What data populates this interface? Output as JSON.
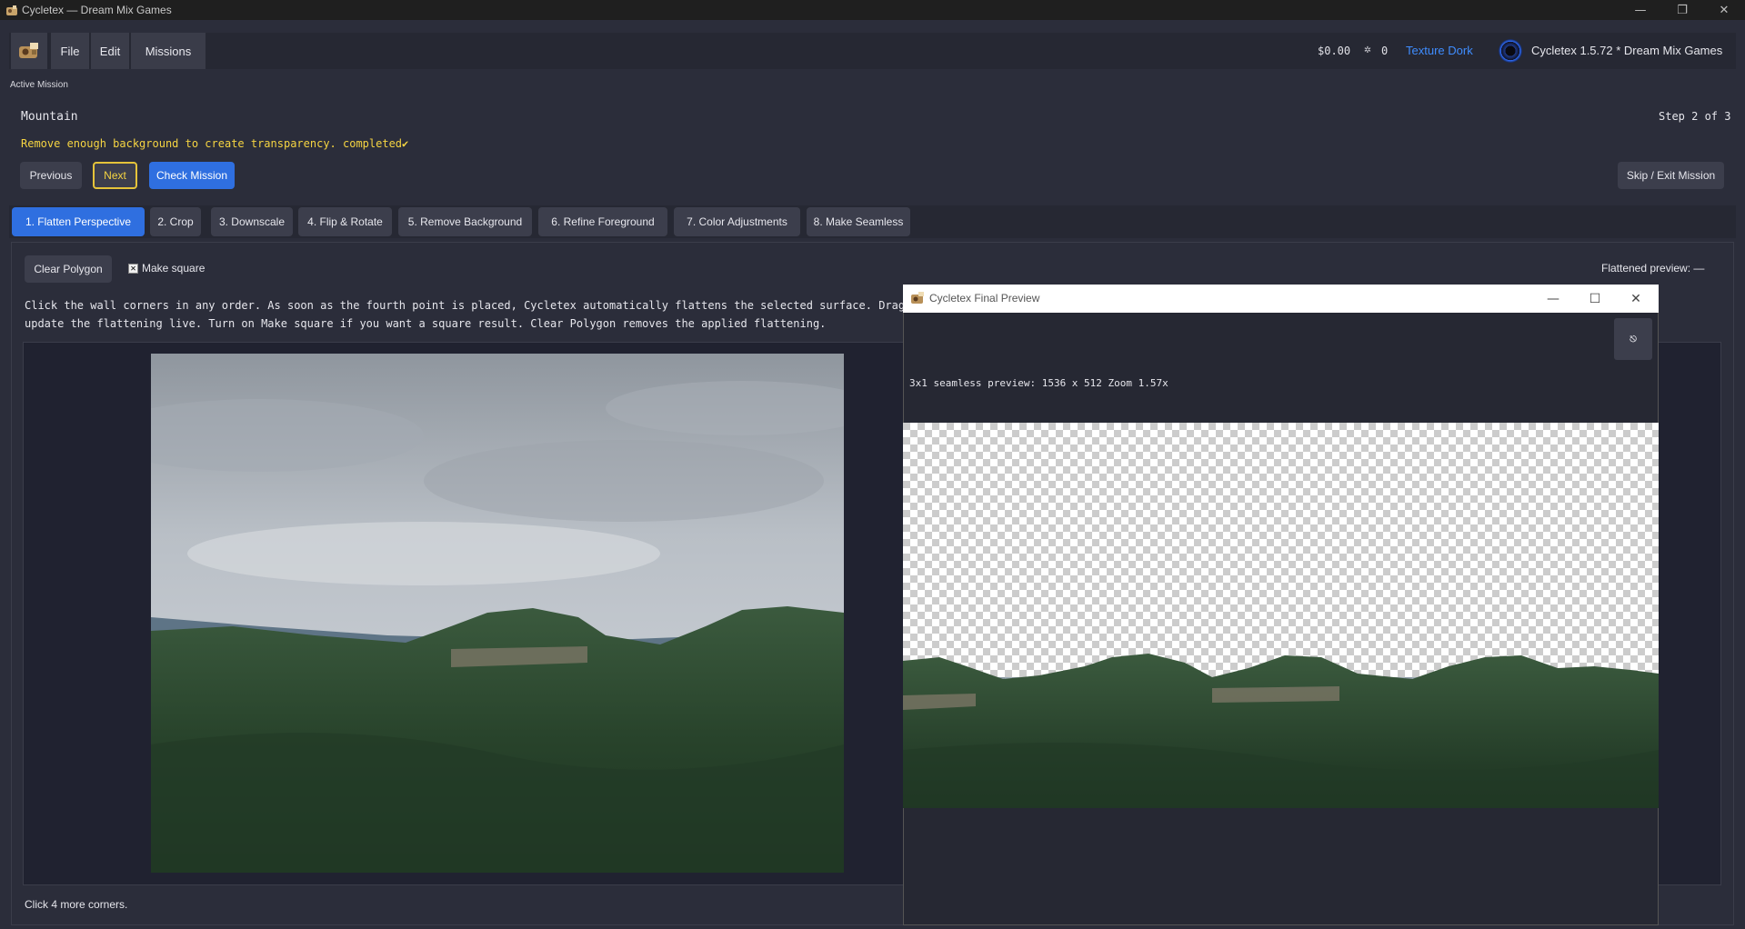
{
  "window": {
    "title": "Cycletex — Dream Mix Games",
    "controls": {
      "minimize": "—",
      "restore": "❐",
      "close": "✕"
    }
  },
  "menu": {
    "items": [
      "File",
      "Edit",
      "Missions"
    ]
  },
  "status_bar": {
    "money": "$0.00",
    "drops": "0",
    "theme": "Texture Dork",
    "version": "Cycletex 1.5.72 * Dream Mix Games"
  },
  "mission": {
    "label": "Active Mission",
    "name": "Mountain",
    "step": "Step 2 of 3",
    "status": "Remove enough background to create transparency. completed✔",
    "buttons": {
      "previous": "Previous",
      "next": "Next",
      "check": "Check Mission",
      "skip": "Skip / Exit Mission"
    }
  },
  "tabs": [
    "1. Flatten Perspective",
    "2. Crop",
    "3. Downscale",
    "4. Flip & Rotate",
    "5. Remove Background",
    "6. Refine Foreground",
    "7. Color Adjustments",
    "8. Make Seamless"
  ],
  "active_tab": 0,
  "flatten": {
    "clear_button": "Clear Polygon",
    "make_square_label": "Make square",
    "make_square_checked": true,
    "status": "Flattened preview: —",
    "instructions_line1": "Click the wall corners in any order. As soon as the fourth point is placed, Cycletex automatically flattens the selected surface. Drag any numbered poi",
    "instructions_line2": "update the flattening live. Turn on Make square if you want a square result. Clear Polygon removes the applied flattening.",
    "hint": "Click 4 more corners."
  },
  "preview": {
    "title": "Cycletex Final Preview",
    "info": "3x1 seamless preview: 1536 x 512  Zoom 1.57x",
    "action_icon": "share-icon"
  },
  "colors": {
    "accent": "#2f6fe0",
    "warning": "#f5d442",
    "link": "#3f8dff"
  }
}
